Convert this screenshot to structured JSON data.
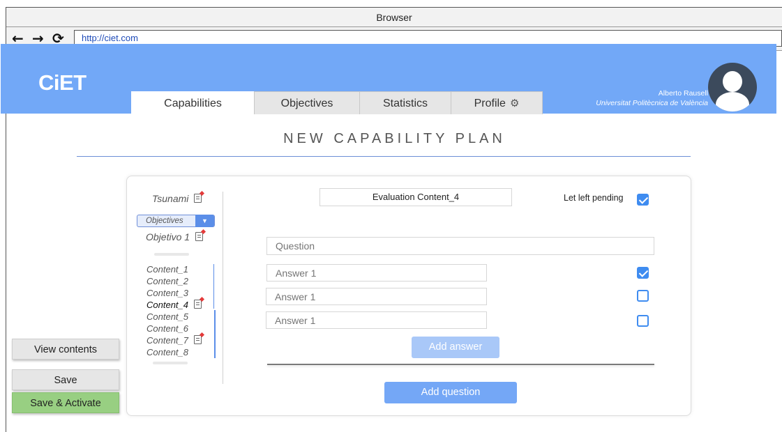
{
  "browser": {
    "window_title": "Browser",
    "url": "http://ciet.com",
    "back_glyph": "←",
    "forward_glyph": "→",
    "reload_glyph": "⟳"
  },
  "header": {
    "logo": "CiET",
    "tabs": [
      {
        "label": "Capabilities",
        "active": true
      },
      {
        "label": "Objectives",
        "active": false
      },
      {
        "label": "Statistics",
        "active": false
      },
      {
        "label": "Profile",
        "active": false,
        "icon": "gear-icon"
      }
    ],
    "user_name": "Alberto Rausell",
    "user_org": "Universitat Politècnica de València",
    "accent_color": "#72a8f7"
  },
  "page": {
    "title": "NEW CAPABILITY PLAN"
  },
  "tree": {
    "root": "Tsunami",
    "dropdown_value": "Objectives",
    "objective": "Objetivo 1",
    "contents": [
      {
        "label": "Content_1",
        "has_icon": false,
        "selected": false
      },
      {
        "label": "Content_2",
        "has_icon": false,
        "selected": false
      },
      {
        "label": "Content_3",
        "has_icon": false,
        "selected": false
      },
      {
        "label": "Content_4",
        "has_icon": true,
        "selected": true
      },
      {
        "label": "Content_5",
        "has_icon": false,
        "selected": false
      },
      {
        "label": "Content_6",
        "has_icon": false,
        "selected": false
      },
      {
        "label": "Content_7",
        "has_icon": true,
        "selected": false
      },
      {
        "label": "Content_8",
        "has_icon": false,
        "selected": false
      }
    ]
  },
  "form": {
    "evaluation_title": "Evaluation Content_4",
    "pending_label": "Let left pending",
    "pending_checked": true,
    "question_placeholder": "Question",
    "answers": [
      {
        "placeholder": "Answer 1",
        "correct": true
      },
      {
        "placeholder": "Answer 1",
        "correct": false
      },
      {
        "placeholder": "Answer 1",
        "correct": false
      }
    ],
    "add_answer_label": "Add answer",
    "add_question_label": "Add question"
  },
  "side_actions": {
    "view_contents": "View contents",
    "save": "Save",
    "save_activate": "Save & Activate"
  }
}
